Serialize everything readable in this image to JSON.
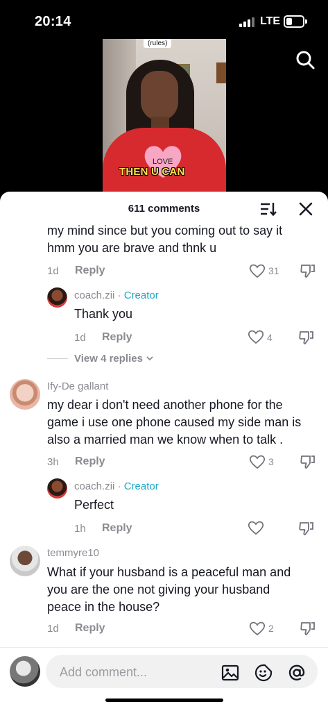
{
  "status": {
    "time": "20:14",
    "network": "LTE"
  },
  "video": {
    "rules_tag": "(rules)",
    "heart_text": "LOVE",
    "caption": "THEN U CAN"
  },
  "sheet": {
    "title": "611 comments"
  },
  "comments": [
    {
      "text_line1": "my mind since but you coming out to say it",
      "text_line2": "hmm you are brave and thnk u",
      "time": "1d",
      "reply_label": "Reply",
      "likes": "31"
    },
    {
      "username": "coach.zii",
      "separator": " · ",
      "creator_label": "Creator",
      "text": "Thank you",
      "time": "1d",
      "reply_label": "Reply",
      "likes": "4",
      "view_replies": "View 4 replies"
    },
    {
      "username": "Ify-De gallant",
      "text_line1": "my dear i don't need another phone for the",
      "text_line2": "game i use one phone caused my side man is",
      "text_line3": "also a married man we know when to talk .",
      "time": "3h",
      "reply_label": "Reply",
      "likes": "3"
    },
    {
      "username": "coach.zii",
      "separator": " · ",
      "creator_label": "Creator",
      "text": "Perfect",
      "time": "1h",
      "reply_label": "Reply"
    },
    {
      "username": "temmyre10",
      "text_line1": "What if your husband is a peaceful man and",
      "text_line2": "you are the one not giving your husband",
      "text_line3": "peace in the house?",
      "time": "1d",
      "reply_label": "Reply",
      "likes": "2"
    }
  ],
  "composer": {
    "placeholder": "Add comment..."
  },
  "icons": {
    "search": "search-icon",
    "sort": "sort-icon",
    "close": "close-icon",
    "like": "heart-icon",
    "dislike": "dislike-icon",
    "image": "image-icon",
    "emoji": "emoji-icon",
    "mention": "mention-icon"
  },
  "colors": {
    "creator_accent": "#20a6c6",
    "muted": "#8a8b91",
    "text": "#161823"
  }
}
